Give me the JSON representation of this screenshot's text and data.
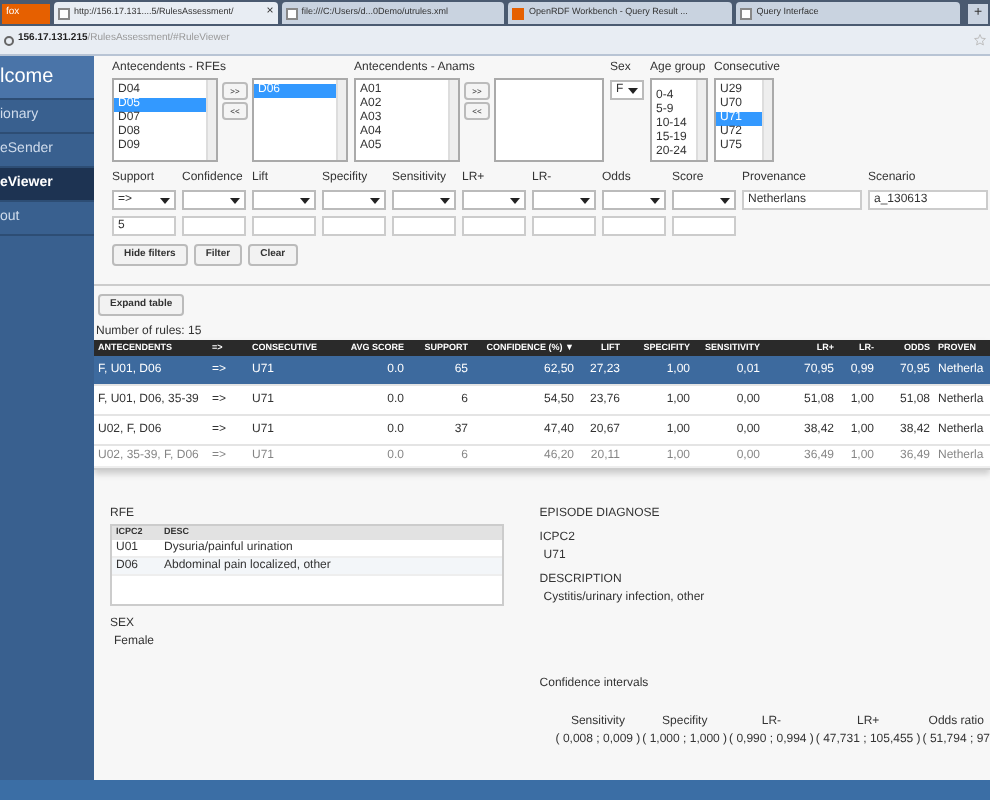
{
  "browser": {
    "menu_button": "fox",
    "tabs": [
      {
        "title": "http://156.17.131....5/RulesAssessment/",
        "selected": true,
        "close": "×"
      },
      {
        "title": "file:///C:/Users/d...0Demo/utrules.xml",
        "selected": false
      },
      {
        "title": "OpenRDF Workbench - Query Result ...",
        "selected": false
      },
      {
        "title": "Query Interface",
        "selected": false
      }
    ],
    "new_tab": "+",
    "address": {
      "host": "156.17.131.215",
      "path": "/RulesAssessment/#RuleViewer"
    }
  },
  "sidebar": {
    "title": "lcome",
    "items": [
      {
        "label": "ionary",
        "selected": false
      },
      {
        "label": "eSender",
        "selected": false
      },
      {
        "label": "eViewer",
        "selected": true
      },
      {
        "label": "out",
        "selected": false
      }
    ]
  },
  "filters": {
    "rfes": {
      "label": "Antecendents - RFEs",
      "options": [
        {
          "label": "D04",
          "selected": false
        },
        {
          "label": "D05",
          "selected": true
        },
        {
          "label": "D07",
          "selected": false
        },
        {
          "label": "D08",
          "selected": false
        },
        {
          "label": "D09",
          "selected": false
        }
      ],
      "add": ">>",
      "remove": "<<",
      "chosen": [
        {
          "label": "D06",
          "selected": true
        }
      ]
    },
    "anams": {
      "label": "Antecendents - Anams",
      "options": [
        {
          "label": "A01",
          "selected": false
        },
        {
          "label": "A02",
          "selected": false
        },
        {
          "label": "A03",
          "selected": false
        },
        {
          "label": "A04",
          "selected": false
        },
        {
          "label": "A05",
          "selected": false
        }
      ],
      "add": ">>",
      "remove": "<<"
    },
    "sex": {
      "label": "Sex",
      "value": "F"
    },
    "age_group": {
      "label": "Age group",
      "options": [
        {
          "label": "0-4",
          "selected": false
        },
        {
          "label": "5-9",
          "selected": false
        },
        {
          "label": "10-14",
          "selected": false
        },
        {
          "label": "15-19",
          "selected": false
        },
        {
          "label": "20-24",
          "selected": false
        }
      ]
    },
    "consecutive": {
      "label": "Consecutive",
      "options": [
        {
          "label": "U29",
          "selected": false
        },
        {
          "label": "U70",
          "selected": false
        },
        {
          "label": "U71",
          "selected": true
        },
        {
          "label": "U72",
          "selected": false
        },
        {
          "label": "U75",
          "selected": false
        }
      ]
    },
    "measures": [
      {
        "label": "Support",
        "operator": "=>",
        "value": "5"
      },
      {
        "label": "Confidence"
      },
      {
        "label": "Lift"
      },
      {
        "label": "Specifity"
      },
      {
        "label": "Sensitivity"
      },
      {
        "label": "LR+"
      },
      {
        "label": "LR-"
      },
      {
        "label": "Odds"
      },
      {
        "label": "Score"
      }
    ],
    "provenance": {
      "label": "Provenance",
      "value": "Netherlans"
    },
    "scenario": {
      "label": "Scenario",
      "value": "a_130613"
    },
    "buttons": [
      "Hide filters",
      "Filter",
      "Clear"
    ]
  },
  "expand_button": "Expand table",
  "rule_count": "Number of rules: 15",
  "table": {
    "columns": [
      "ANTECENDENTS",
      "=>",
      "CONSECUTIVE",
      "AVG SCORE",
      "SUPPORT",
      "CONFIDENCE (%) ▼",
      "LIFT",
      "SPECIFITY",
      "SENSITIVITY",
      "LR+",
      "LR-",
      "ODDS",
      "PROVEN"
    ],
    "rows": [
      {
        "selected": true,
        "cells": [
          "F, U01, D06",
          "=>",
          "U71",
          "0.0",
          "65",
          "62,50",
          "27,23",
          "1,00",
          "0,01",
          "70,95",
          "0,99",
          "70,95",
          "Netherla"
        ]
      },
      {
        "selected": false,
        "cells": [
          "F, U01, D06, 35-39",
          "=>",
          "U71",
          "0.0",
          "6",
          "54,50",
          "23,76",
          "1,00",
          "0,00",
          "51,08",
          "1,00",
          "51,08",
          "Netherla"
        ]
      },
      {
        "selected": false,
        "cells": [
          "U02, F, D06",
          "=>",
          "U71",
          "0.0",
          "37",
          "47,40",
          "20,67",
          "1,00",
          "0,00",
          "38,42",
          "1,00",
          "38,42",
          "Netherla"
        ]
      },
      {
        "selected": false,
        "cells": [
          "U02, 35-39, F, D06",
          "=>",
          "U71",
          "0.0",
          "6",
          "46,20",
          "20,11",
          "1,00",
          "0,00",
          "36,49",
          "1,00",
          "36,49",
          "Netherla"
        ]
      }
    ]
  },
  "details": {
    "rfe": {
      "title": "RFE",
      "columns": [
        "ICPC2",
        "DESC"
      ],
      "rows": [
        [
          "U01",
          "Dysuria/painful urination"
        ],
        [
          "D06",
          "Abdominal pain localized, other"
        ]
      ]
    },
    "sex": {
      "title": "SEX",
      "value": "Female"
    },
    "episode": {
      "title": "EPISODE DIAGNOSE",
      "icpc2_label": "ICPC2",
      "icpc2": "U71",
      "description_label": "DESCRIPTION",
      "description": "Cystitis/urinary infection, other"
    },
    "confidence": {
      "title": "Confidence intervals",
      "items": [
        {
          "label": "Sensitivity",
          "value": "( 0,008 ; 0,009 )"
        },
        {
          "label": "Specifity",
          "value": "( 1,000 ; 1,000 )"
        },
        {
          "label": "LR-",
          "value": "( 0,990 ; 0,994 )"
        },
        {
          "label": "LR+",
          "value": "( 47,731 ; 105,455 )"
        },
        {
          "label": "Odds ratio",
          "value": "( 51,794 ; 97"
        }
      ]
    }
  }
}
